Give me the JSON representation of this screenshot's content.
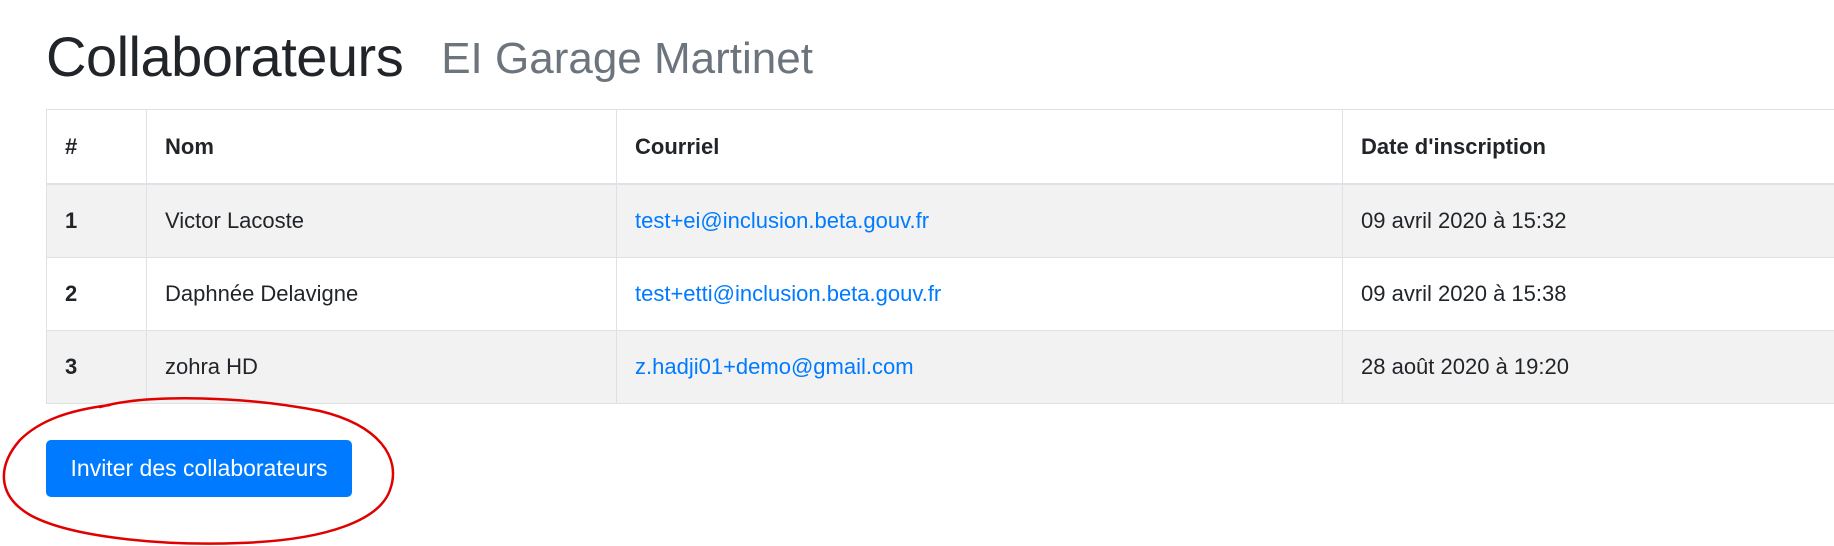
{
  "header": {
    "title": "Collaborateurs",
    "subtitle": "EI Garage Martinet"
  },
  "table": {
    "columns": [
      "#",
      "Nom",
      "Courriel",
      "Date d'inscription"
    ],
    "rows": [
      {
        "num": "1",
        "name": "Victor Lacoste",
        "email": "test+ei@inclusion.beta.gouv.fr",
        "date": "09 avril 2020 à 15:32"
      },
      {
        "num": "2",
        "name": "Daphnée Delavigne",
        "email": "test+etti@inclusion.beta.gouv.fr",
        "date": "09 avril 2020 à 15:38"
      },
      {
        "num": "3",
        "name": "zohra HD",
        "email": "z.hadji01+demo@gmail.com",
        "date": "28 août 2020 à 19:20"
      }
    ]
  },
  "actions": {
    "invite_label": "Inviter des collaborateurs"
  },
  "colors": {
    "primary": "#007bff",
    "annotation": "#e00000",
    "striped_row": "#f2f2f2"
  }
}
